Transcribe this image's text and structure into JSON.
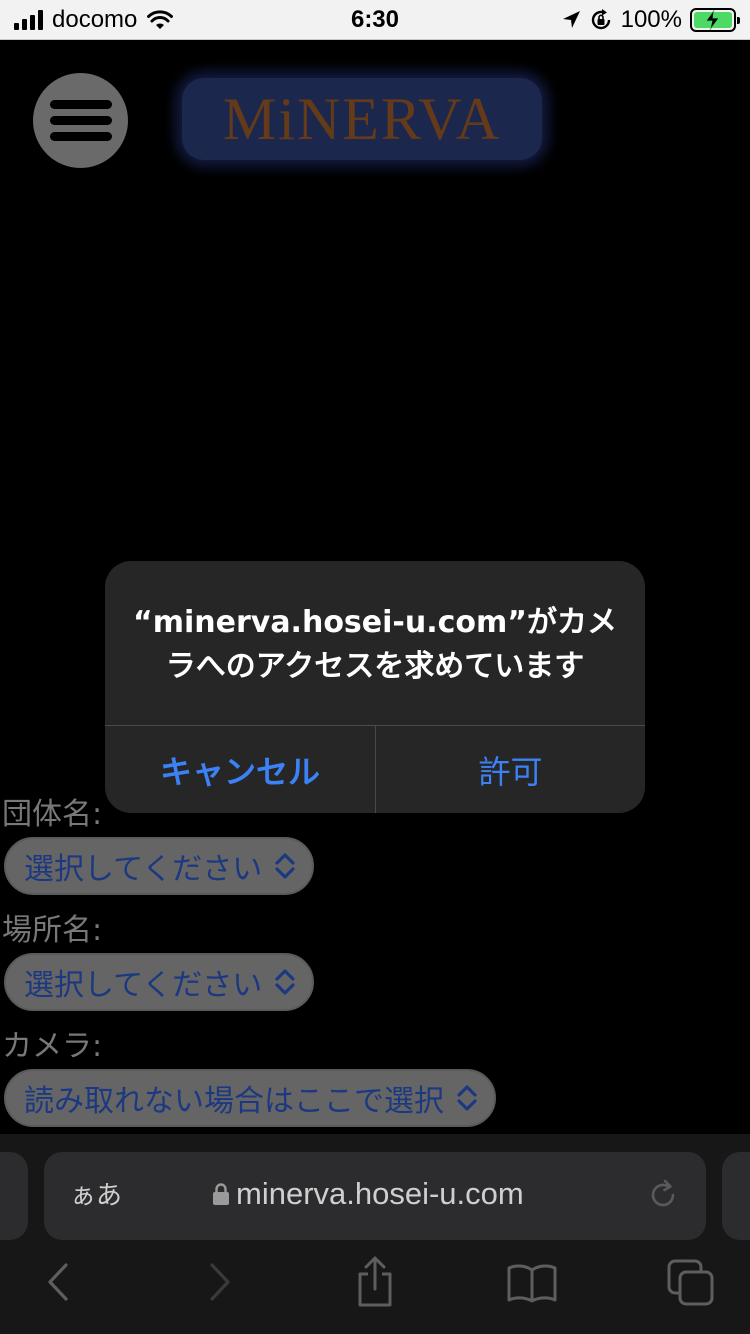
{
  "status_bar": {
    "carrier": "docomo",
    "time": "6:30",
    "battery_percent": "100%",
    "battery_level": 1.0,
    "icons": [
      "signal-icon",
      "wifi-icon",
      "location-arrow-icon",
      "rotation-lock-icon",
      "battery-charging-icon"
    ]
  },
  "header": {
    "menu_icon": "hamburger-icon",
    "logo_text": "MiNERVA"
  },
  "form": {
    "group_label": "団体名:",
    "group_select_value": "選択してください",
    "place_label": "場所名:",
    "place_select_value": "選択してください",
    "camera_label": "カメラ:",
    "camera_select_value": "読み取れない場合はここで選択"
  },
  "alert": {
    "message": "“minerva.hosei-u.com”がカメラへのアクセスを求めています",
    "cancel_label": "キャンセル",
    "allow_label": "許可"
  },
  "browser": {
    "text_size_label": "ぁあ",
    "url": "minerva.hosei-u.com",
    "toolbar_icons": [
      "back-icon",
      "forward-icon",
      "share-icon",
      "bookmarks-icon",
      "tabs-icon"
    ]
  },
  "colors": {
    "accent_blue": "#3b82f6",
    "select_text": "#2b57c6",
    "logo_text": "#9a5a26",
    "logo_bg": "#2c3c79",
    "battery_green": "#4cd964"
  }
}
